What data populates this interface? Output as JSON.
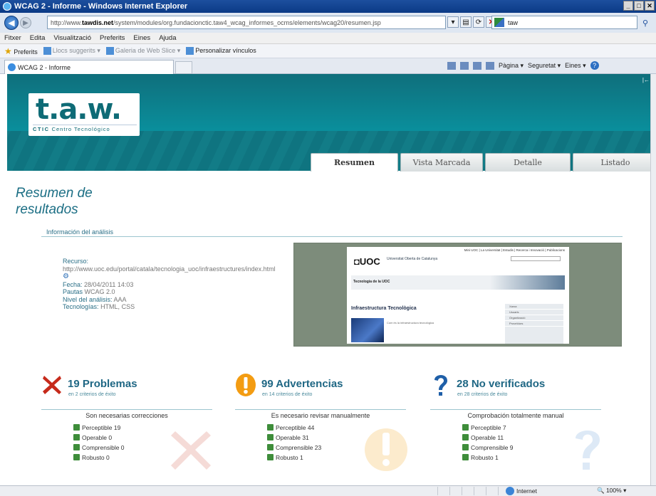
{
  "window": {
    "title": "WCAG 2 - Informe - Windows Internet Explorer"
  },
  "address": {
    "url_prefix": "http://www.",
    "url_domain": "tawdis.net",
    "url_path": "/system/modules/org.fundacionctic.taw4_wcag_informes_ocms/elements/wcag20/resumen.jsp",
    "search_value": "taw"
  },
  "menu": [
    "Fitxer",
    "Edita",
    "Visualització",
    "Preferits",
    "Eines",
    "Ajuda"
  ],
  "favorites": {
    "label": "Preferits",
    "suggested": "Llocs suggerits ▾",
    "webslice": "Galeria de Web Slice ▾",
    "custom": "Personalizar vínculos"
  },
  "browser_tab": {
    "label": "WCAG 2 - Informe"
  },
  "commandbar": {
    "page": "Pàgina ▾",
    "security": "Seguretat ▾",
    "tools": "Eines ▾"
  },
  "site": {
    "logo_main": "t.a.w.",
    "logo_org": "CTIC",
    "logo_sub": "Centro Tecnológico",
    "tabs": [
      "Resumen",
      "Vista Marcada",
      "Detalle",
      "Listado"
    ],
    "page_title": "Resumen de resultados",
    "info_header": "Información del análisis"
  },
  "analysis": {
    "resource_label": "Recurso:",
    "resource_url": "http://www.uoc.edu/portal/catala/tecnologia_uoc/infraestructures/index.html",
    "date_label": "Fecha:",
    "date_value": "28/04/2011 14:03",
    "guidelines_label": "Pautas",
    "guidelines_value": "WCAG 2.0",
    "level_label": "Nivel del análisis:",
    "level_value": "AAA",
    "tech_label": "Tecnologías:",
    "tech_value": "HTML, CSS"
  },
  "preview": {
    "toplinks": "Mini UOC | La Universitat | Estudis | Recerca i Innovació | Publicacions",
    "logo": "UOC",
    "university": "Universitat Oberta de Catalunya",
    "band_title": "Tecnologia de la UOC",
    "heading": "Infraestructura Tecnològica",
    "article_title": "Com és la infraestructura tecnològica",
    "side_items": [
      "Xarxa",
      "Usuaris",
      "Organització",
      "Proveïdors"
    ]
  },
  "summary": [
    {
      "title": "19 Problemas",
      "subtitle": "en 2 criterios de éxito",
      "caption": "Son necesarias correcciones",
      "items": [
        "Perceptible 19",
        "Operable 0",
        "Comprensible 0",
        "Robusto 0"
      ],
      "icon": "error-icon",
      "color": "#c62a1b"
    },
    {
      "title": "99 Advertencias",
      "subtitle": "en 14 criterios de éxito",
      "caption": "Es necesario revisar manualmente",
      "items": [
        "Perceptible 44",
        "Operable 31",
        "Comprensible 23",
        "Robusto 1"
      ],
      "icon": "warning-icon",
      "color": "#f39c12"
    },
    {
      "title": "28 No verificados",
      "subtitle": "en 28 criterios de éxito",
      "caption": "Comprobación totalmente manual",
      "items": [
        "Perceptible 7",
        "Operable 11",
        "Comprensible 9",
        "Robusto 1"
      ],
      "icon": "question-icon",
      "color": "#1f5fa8"
    }
  ],
  "status": {
    "zone": "Internet",
    "zoom": "100%"
  }
}
